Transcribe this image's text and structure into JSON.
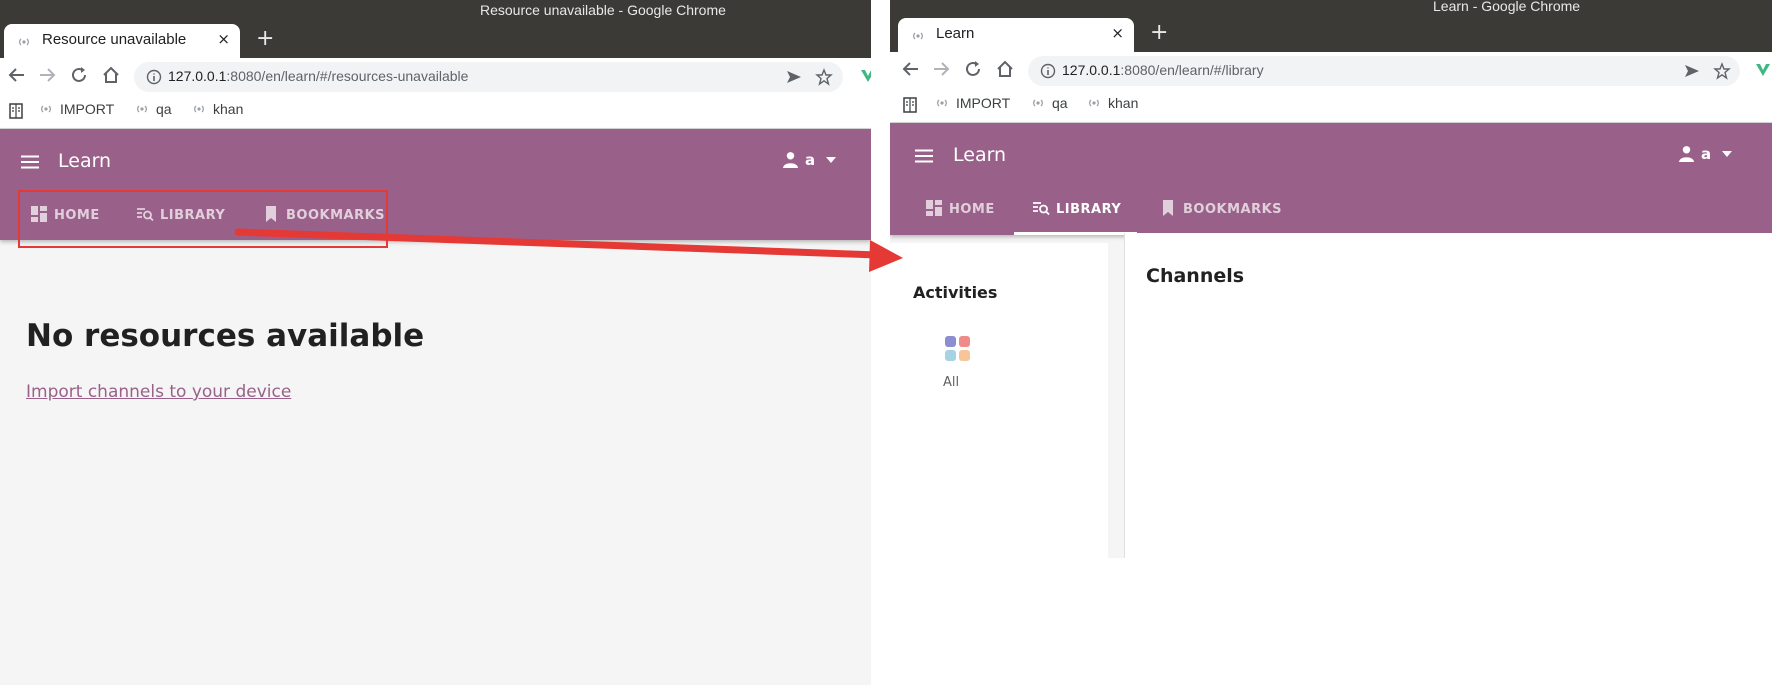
{
  "left_window": {
    "window_title": "Resource unavailable - Google Chrome",
    "tab_title": "Resource unavailable",
    "tab_close": "×",
    "new_tab": "+",
    "url_host": "127.0.0.1",
    "url_rest": ":8080/en/learn/#/resources-unavailable",
    "bookmarks": [
      "IMPORT",
      "qa",
      "khan"
    ],
    "app_title": "Learn",
    "user_label": "a",
    "nav_tabs": [
      "HOME",
      "LIBRARY",
      "BOOKMARKS"
    ],
    "heading": "No resources available",
    "import_link": "Import channels to your device"
  },
  "right_window": {
    "window_title": "Learn - Google Chrome",
    "tab_title": "Learn",
    "tab_close": "×",
    "new_tab": "+",
    "url_host": "127.0.0.1",
    "url_rest": ":8080/en/learn/#/library",
    "bookmarks": [
      "IMPORT",
      "qa",
      "khan"
    ],
    "app_title": "Learn",
    "user_label": "a",
    "nav_tabs": [
      "HOME",
      "LIBRARY",
      "BOOKMARKS"
    ],
    "active_tab": "LIBRARY",
    "activities_heading": "Activities",
    "all_label": "All",
    "channels_heading": "Channels"
  },
  "colors": {
    "appbar": "#996189",
    "annotation": "#e53935",
    "link": "#996189"
  },
  "icons": {
    "favicon": "antenna-icon",
    "home_tab": "dashboard-icon",
    "library_tab": "library-search-icon",
    "bookmarks_tab": "bookmark-icon",
    "menu": "hamburger-icon",
    "user": "person-icon",
    "activities_all": "grid-dots-icon"
  }
}
